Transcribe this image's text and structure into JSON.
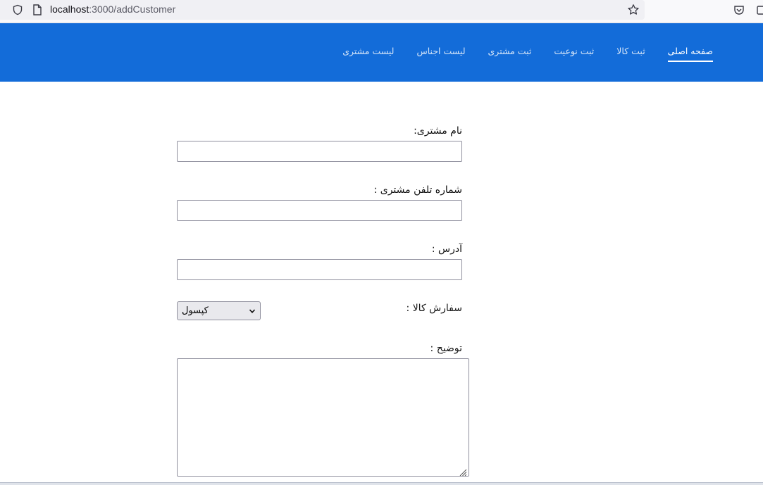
{
  "browser": {
    "url_host": "localhost",
    "url_path": ":3000/addCustomer"
  },
  "nav": {
    "items": [
      {
        "label": "صفحه اصلی",
        "active": true
      },
      {
        "label": "ثبت کالا",
        "active": false
      },
      {
        "label": "ثبت نوعیت",
        "active": false
      },
      {
        "label": "ثبت مشتری",
        "active": false
      },
      {
        "label": "لیست اجناس",
        "active": false
      },
      {
        "label": "لیست مشتری",
        "active": false
      }
    ]
  },
  "form": {
    "customer_name_label": "نام مشتری:",
    "customer_phone_label": "شماره تلفن مشتری :",
    "address_label": "آدرس :",
    "order_label": "سفارش کالا :",
    "order_selected": "کپسول",
    "description_label": "توضیح :"
  },
  "colors": {
    "navbar": "#136cd9",
    "nav_text": "#ffffff"
  }
}
